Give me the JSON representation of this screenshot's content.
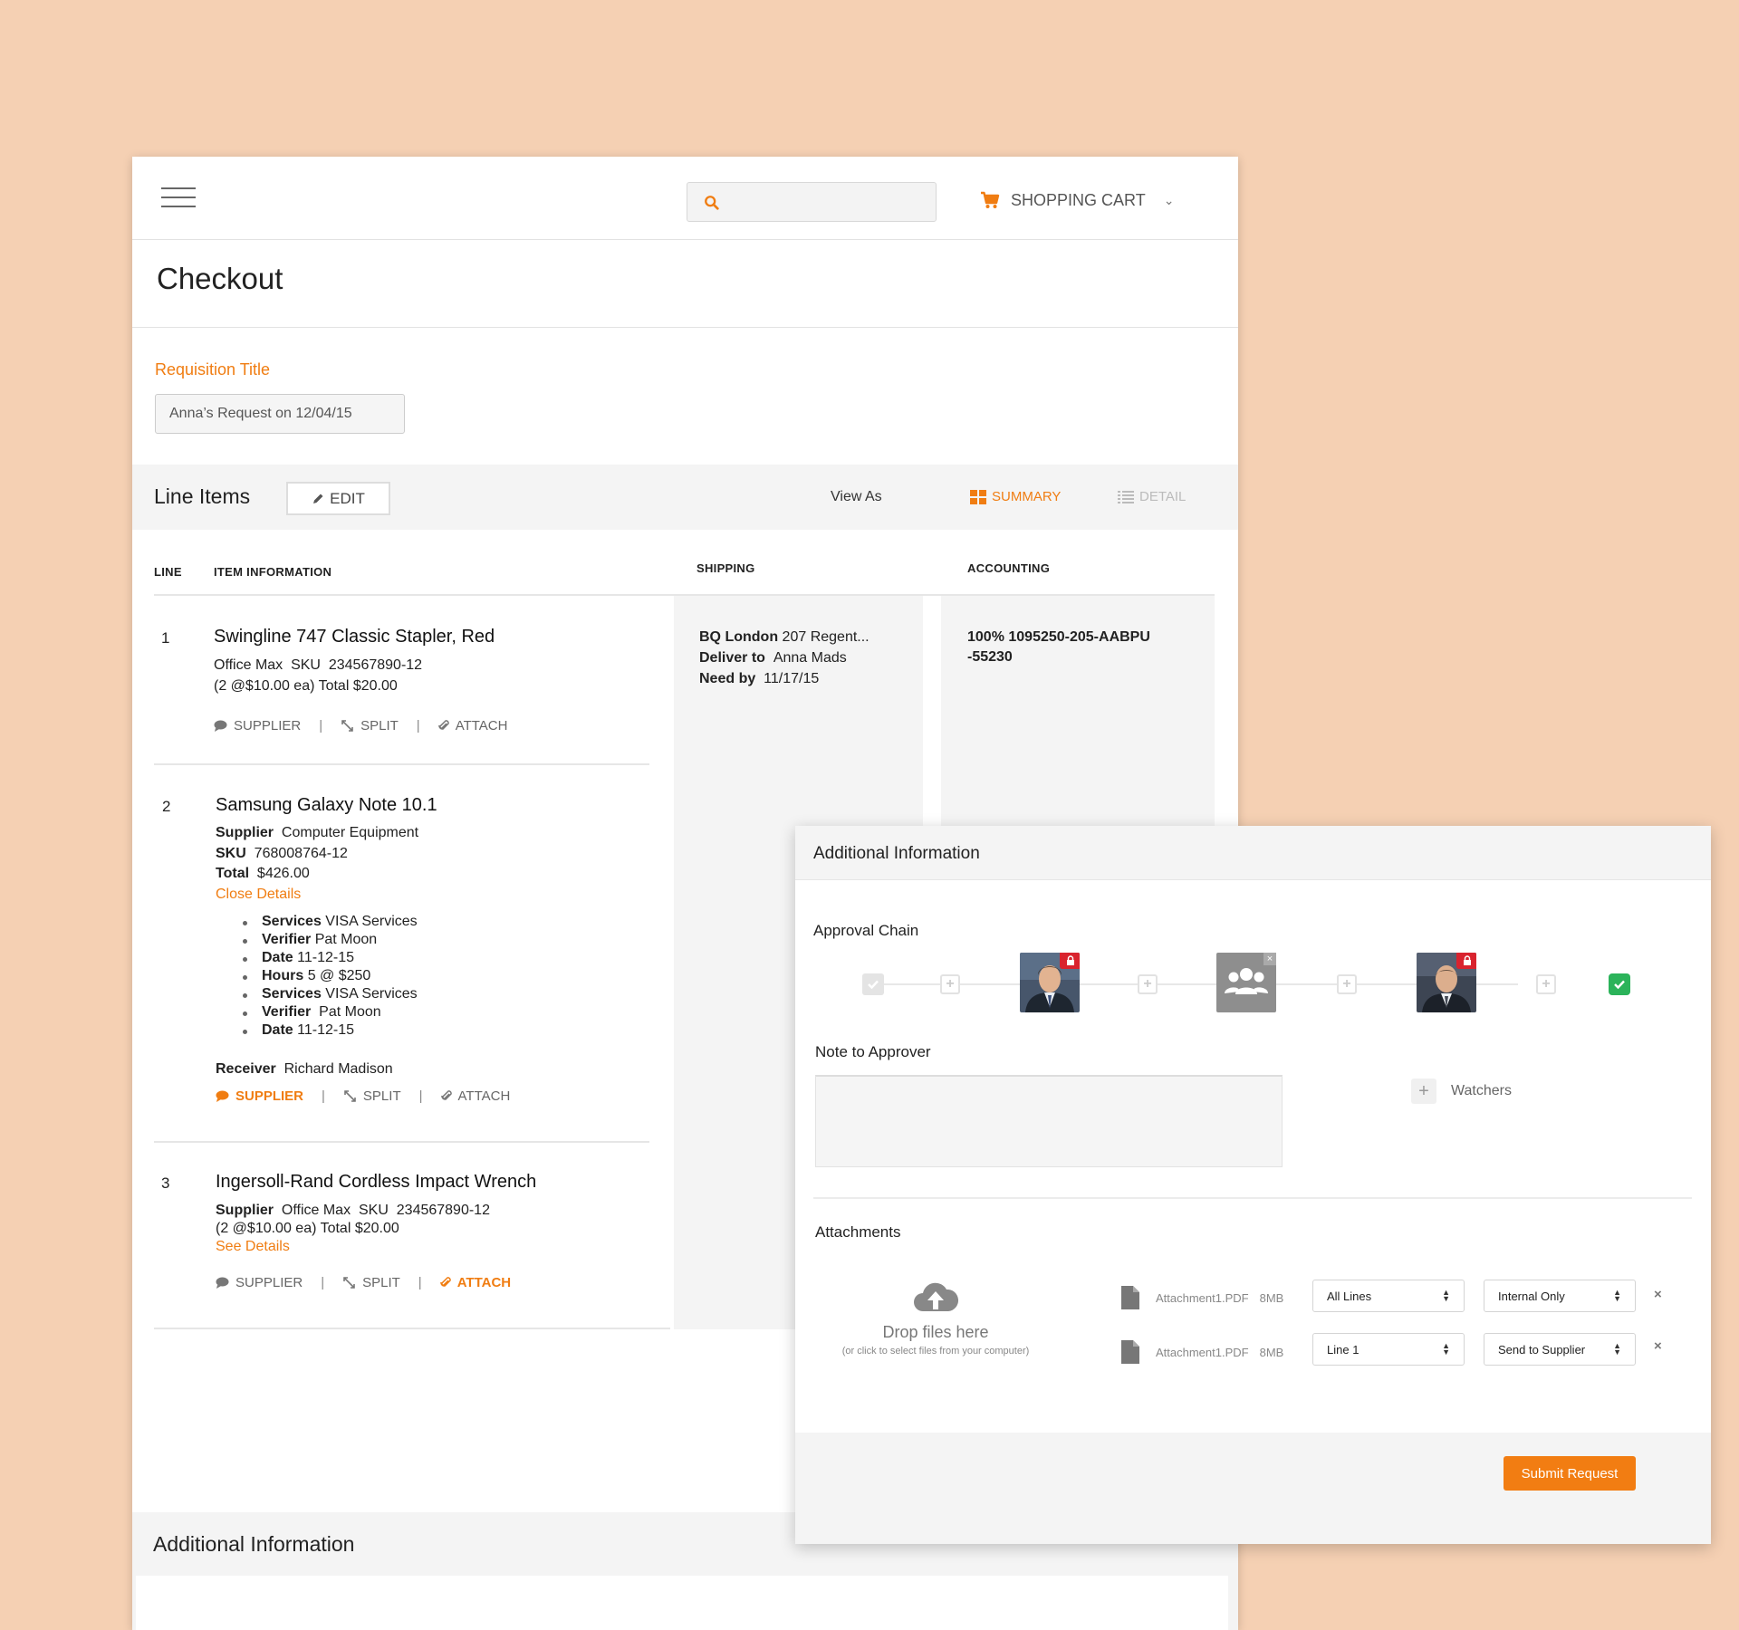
{
  "header": {
    "search_placeholder": "",
    "cart_label": "SHOPPING CART"
  },
  "page": {
    "title": "Checkout",
    "requisition_label": "Requisition Title",
    "requisition_value": "Anna’s Request on 12/04/15"
  },
  "line_items_bar": {
    "title": "Line Items",
    "edit_label": "EDIT",
    "view_as_label": "View As",
    "summary_label": "SUMMARY",
    "detail_label": "DETAIL"
  },
  "table": {
    "headers": {
      "line": "LINE",
      "item_information": "ITEM INFORMATION",
      "shipping": "SHIPPING",
      "accounting": "ACCOUNTING"
    },
    "action_labels": {
      "supplier": "SUPPLIER",
      "split": "SPLIT",
      "attach": "ATTACH"
    },
    "items": [
      {
        "line": "1",
        "title": "Swingline 747 Classic Stapler, Red",
        "row1_supplier": "Office Max",
        "row1_sku_label": "SKU",
        "row1_sku": "234567890-12",
        "row2": "(2 @$10.00 ea) Total $20.00",
        "shipping": {
          "location_label": "BQ London",
          "location_value": "207 Regent...",
          "deliver_label": "Deliver to",
          "deliver_value": "Anna Mads",
          "need_label": "Need by",
          "need_value": "11/17/15"
        },
        "accounting_line1": "100% 1095250-205-AABPU",
        "accounting_line2": "-55230"
      },
      {
        "line": "2",
        "title": "Samsung Galaxy Note 10.1",
        "supplier_label": "Supplier",
        "supplier_value": "Computer Equipment",
        "sku_label": "SKU",
        "sku_value": "768008764-12",
        "total_label": "Total",
        "total_value": "$426.00",
        "details_link": "Close Details",
        "details": [
          {
            "label": "Services",
            "value": "VISA Services"
          },
          {
            "label": "Verifier",
            "value": "Pat Moon"
          },
          {
            "label": "Date",
            "value": "11-12-15"
          },
          {
            "label": "Hours",
            "value": "5 @ $250"
          },
          {
            "label": "Services",
            "value": "VISA Services"
          },
          {
            "label": "Verifier",
            "value": "Pat Moon"
          },
          {
            "label": "Date",
            "value": "11-12-15"
          }
        ],
        "receiver_label": "Receiver",
        "receiver_value": "Richard Madison"
      },
      {
        "line": "3",
        "title": "Ingersoll-Rand Cordless Impact Wrench",
        "supplier_label": "Supplier",
        "supplier_value": "Office Max",
        "sku_label": "SKU",
        "sku_value": "234567890-12",
        "row2": "(2 @$10.00 ea) Total  $20.00",
        "details_link": "See Details"
      }
    ]
  },
  "bottom_section": {
    "title": "Additional Information"
  },
  "modal": {
    "title": "Additional Information",
    "approval_chain_label": "Approval Chain",
    "note_label": "Note to Approver",
    "watchers_label": "Watchers",
    "attachments_label": "Attachments",
    "drop_text": "Drop files here",
    "drop_subtext": "(or click to select files from your computer)",
    "attachments": [
      {
        "name": "Attachment1.PDF",
        "size": "8MB",
        "scope": "All Lines",
        "visibility": "Internal Only"
      },
      {
        "name": "Attachment1.PDF",
        "size": "8MB",
        "scope": "Line 1",
        "visibility": "Send to Supplier"
      }
    ],
    "submit_label": "Submit Request"
  },
  "colors": {
    "background": "#f5d0b3",
    "accent": "#f07d12",
    "approved": "#2bb35a",
    "lock": "#d9232e"
  }
}
